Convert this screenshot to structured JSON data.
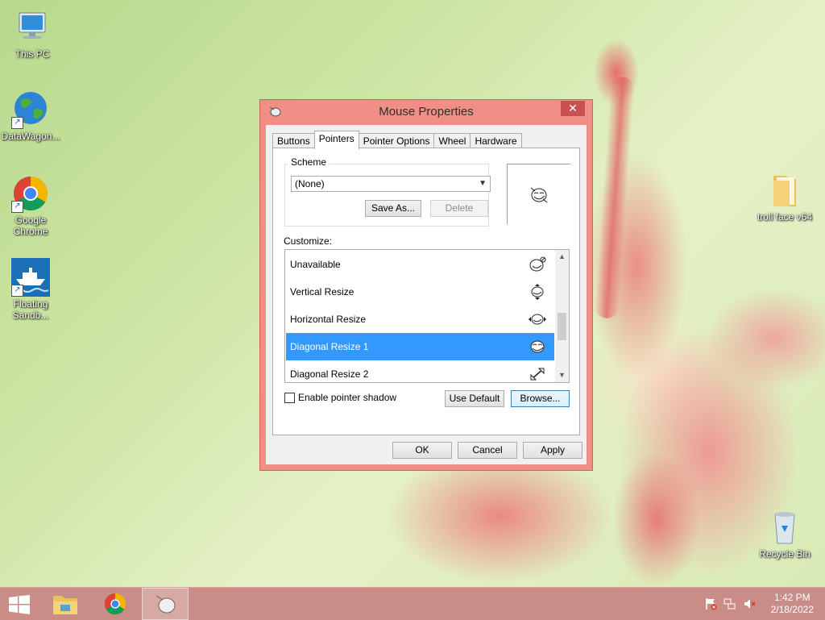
{
  "desktop": {
    "icons": [
      {
        "label": "This PC",
        "icon": "computer-icon"
      },
      {
        "label": "DataWagon...",
        "icon": "globe-icon"
      },
      {
        "label": "Google Chrome",
        "icon": "chrome-icon"
      },
      {
        "label": "Floating Sandb...",
        "icon": "ship-icon"
      },
      {
        "label": "troll face v64",
        "icon": "folder-icon"
      },
      {
        "label": "Recycle Bin",
        "icon": "recycle-bin-icon"
      }
    ]
  },
  "dialog": {
    "title": "Mouse Properties",
    "close_label": "✕",
    "tabs": [
      "Buttons",
      "Pointers",
      "Pointer Options",
      "Wheel",
      "Hardware"
    ],
    "active_tab": "Pointers",
    "scheme": {
      "group_label": "Scheme",
      "selected": "(None)",
      "save_as_label": "Save As...",
      "delete_label": "Delete"
    },
    "customize": {
      "label": "Customize:",
      "items": [
        {
          "label": "Unavailable",
          "icon": "troll-unavailable-cursor-icon"
        },
        {
          "label": "Vertical Resize",
          "icon": "troll-vertical-resize-cursor-icon"
        },
        {
          "label": "Horizontal Resize",
          "icon": "troll-horizontal-resize-cursor-icon"
        },
        {
          "label": "Diagonal Resize 1",
          "icon": "troll-diagonal-resize-cursor-icon",
          "selected": true
        },
        {
          "label": "Diagonal Resize 2",
          "icon": "diagonal-resize-arrow-icon"
        }
      ]
    },
    "shadow_label": "Enable pointer shadow",
    "shadow_checked": false,
    "use_default_label": "Use Default",
    "browse_label": "Browse...",
    "ok_label": "OK",
    "cancel_label": "Cancel",
    "apply_label": "Apply",
    "accent_color": "#ef8f86",
    "selection_color": "#3399ff"
  },
  "taskbar": {
    "time": "1:42 PM",
    "date": "2/18/2022",
    "color": "#c98c86"
  }
}
